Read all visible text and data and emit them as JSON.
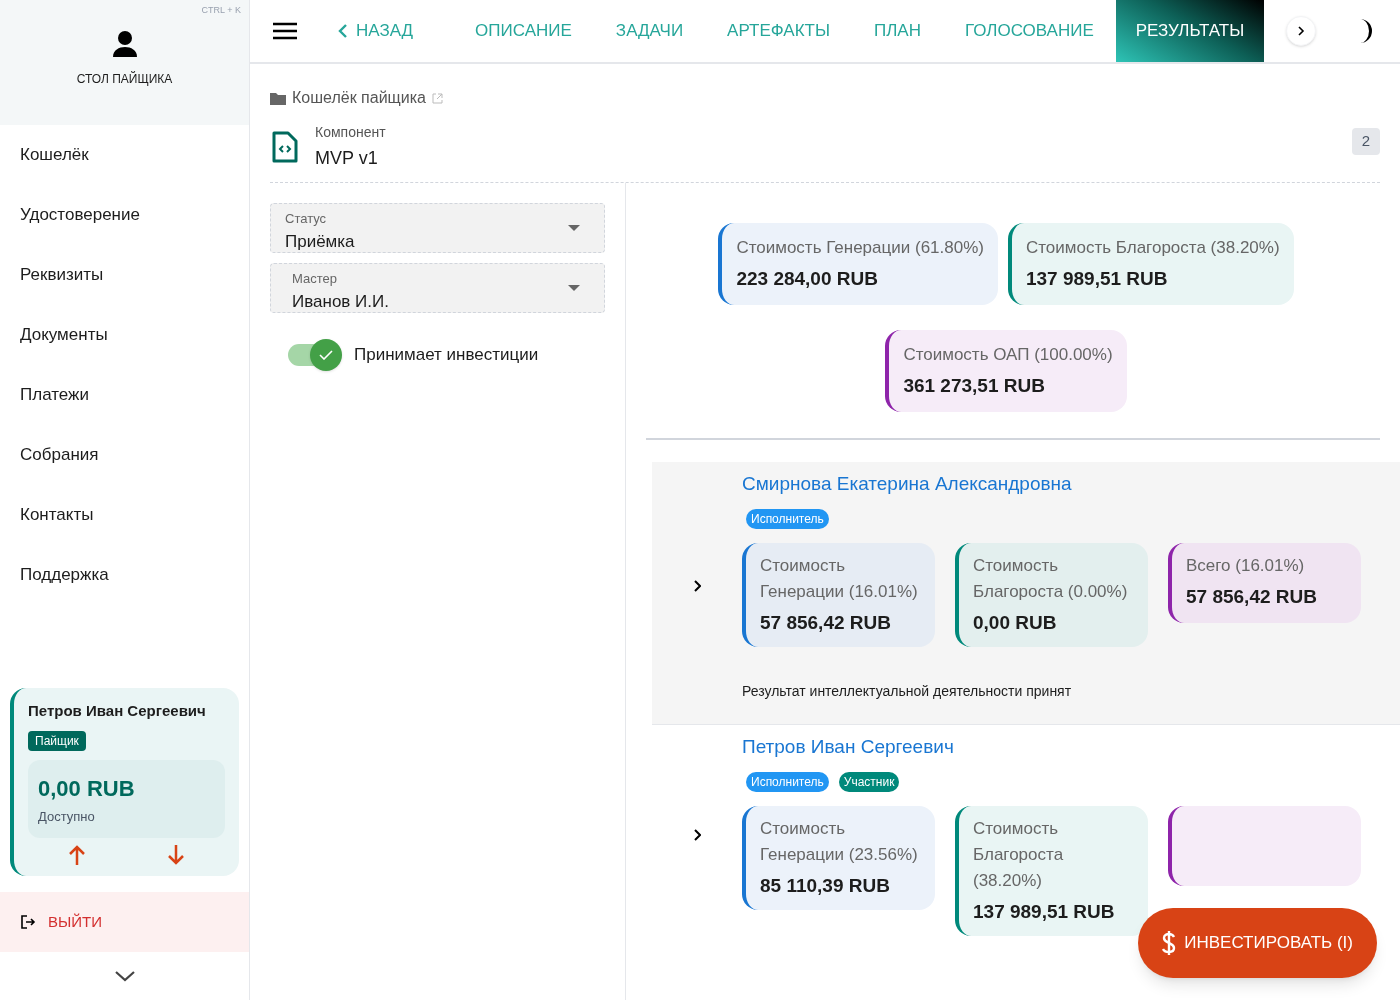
{
  "sidebar": {
    "shortcut": "CTRL + K",
    "title": "СТОЛ ПАЙЩИКА",
    "items": [
      "Кошелёк",
      "Удостоверение",
      "Реквизиты",
      "Документы",
      "Платежи",
      "Собрания",
      "Контакты",
      "Поддержка"
    ],
    "account": {
      "name": "Петров Иван Сергеевич",
      "role": "Пайщик",
      "balance": "0,00 RUB",
      "balance_label": "Доступно"
    },
    "logout": "ВЫЙТИ"
  },
  "nav": {
    "back": "НАЗАД",
    "tabs": [
      {
        "label": "ОПИСАНИЕ",
        "selected": false
      },
      {
        "label": "ЗАДАЧИ",
        "selected": false
      },
      {
        "label": "АРТЕФАКТЫ",
        "selected": false
      },
      {
        "label": "ПЛАН",
        "selected": false
      },
      {
        "label": "ГОЛОСОВАНИЕ",
        "selected": false
      },
      {
        "label": "РЕЗУЛЬТАТЫ",
        "selected": true
      }
    ]
  },
  "breadcrumb": "Кошелёк пайщика",
  "component": {
    "label": "Компонент",
    "name": "MVP v1",
    "count": "2"
  },
  "fields": [
    {
      "label": "Статус",
      "value": "Приёмка"
    },
    {
      "label": "Мастер",
      "value": "Иванов И.И."
    }
  ],
  "toggle": {
    "label": "Принимает инвестиции",
    "on": true
  },
  "summary": [
    {
      "kind": "generation",
      "label": "Стоимость Генерации (61.80%)",
      "value": "223 284,00 RUB"
    },
    {
      "kind": "growth",
      "label": "Стоимость Благороста (38.20%)",
      "value": "137 989,51 RUB"
    },
    {
      "kind": "total",
      "label": "Стоимость ОАП (100.00%)",
      "value": "361 273,51 RUB"
    }
  ],
  "participants": [
    {
      "name": "Смирнова Екатерина Александровна",
      "shaded": true,
      "tags": [
        {
          "label": "Исполнитель",
          "color": "#2196f3"
        }
      ],
      "cards": [
        {
          "kind": "generation",
          "label": "Стоимость Генерации (16.01%)",
          "value": "57 856,42 RUB"
        },
        {
          "kind": "growth",
          "label": "Стоимость Благороста (0.00%)",
          "value": "0,00 RUB"
        },
        {
          "kind": "total",
          "label": "Всего (16.01%)",
          "value": "57 856,42 RUB"
        }
      ],
      "note": "Результат интеллектуальной деятельности принят"
    },
    {
      "name": "Петров Иван Сергеевич",
      "shaded": false,
      "tags": [
        {
          "label": "Исполнитель",
          "color": "#2196f3"
        },
        {
          "label": "Участник",
          "color": "#00897b"
        }
      ],
      "cards": [
        {
          "kind": "generation",
          "label": "Стоимость Генерации (23.56%)",
          "value": "85 110,39 RUB"
        },
        {
          "kind": "growth",
          "label": "Стоимость Благороста (38.20%)",
          "value": "137 989,51 RUB"
        },
        {
          "kind": "total"
        }
      ]
    }
  ],
  "fab": "ИНВЕСТИРОВАТЬ (I)"
}
